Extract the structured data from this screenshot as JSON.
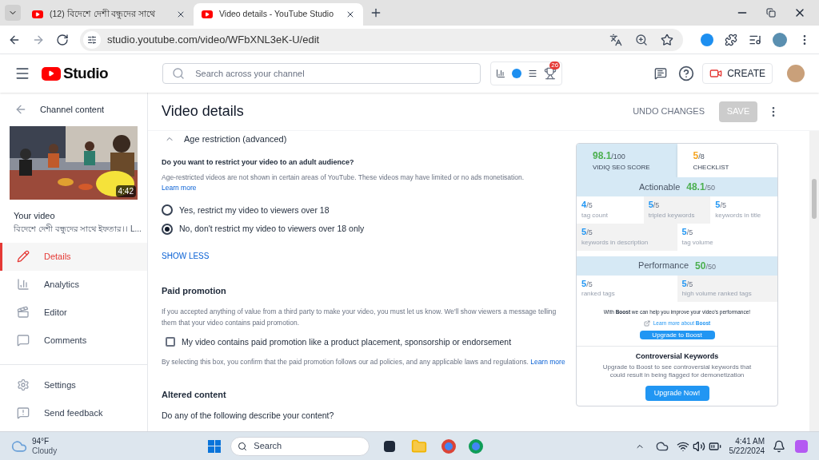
{
  "browser": {
    "tabs": [
      {
        "title": "(12) বিদেশে দেশী বন্ধুদের সাথে",
        "selected": false
      },
      {
        "title": "Video details - YouTube Studio",
        "selected": true
      }
    ],
    "url": "studio.youtube.com/video/WFbXNL3eK-U/edit"
  },
  "header": {
    "logo": "Studio",
    "search_placeholder": "Search across your channel",
    "trophy_badge": "26",
    "create": "CREATE"
  },
  "sidebar": {
    "back": "Channel content",
    "duration": "4:42",
    "your_video": "Your video",
    "video_title": "বিদেশে দেশী বন্ধুদের সাথে ইফতার।। L...",
    "nav": [
      {
        "kind": "details",
        "label": "Details",
        "selected": true
      },
      {
        "kind": "analytics",
        "label": "Analytics",
        "selected": false
      },
      {
        "kind": "editor",
        "label": "Editor",
        "selected": false
      },
      {
        "kind": "comments",
        "label": "Comments",
        "selected": false
      }
    ],
    "footer": [
      {
        "kind": "settings",
        "label": "Settings"
      },
      {
        "kind": "feedback",
        "label": "Send feedback"
      }
    ]
  },
  "page": {
    "title": "Video details",
    "undo": "UNDO CHANGES",
    "save": "SAVE",
    "save_disabled": true,
    "age": {
      "heading": "Age restriction (advanced)",
      "expanded": true,
      "question": "Do you want to restrict your video to an adult audience?",
      "note": "Age-restricted videos are not shown in certain areas of YouTube. These videos may have limited or no ads monetisation.",
      "learn_more": "Learn more",
      "options": [
        {
          "label": "Yes, restrict my video to viewers over 18",
          "selected": false
        },
        {
          "label": "No, don't restrict my video to viewers over 18 only",
          "selected": true
        }
      ],
      "show_less": "SHOW LESS"
    },
    "paid": {
      "heading": "Paid promotion",
      "note": "If you accepted anything of value from a third party to make your video, you must let us know. We'll show viewers a message telling them that your video contains paid promotion.",
      "checkbox": {
        "label": "My video contains paid promotion like a product placement, sponsorship or endorsement",
        "checked": false
      },
      "disclaimer": "By selecting this box, you confirm that the paid promotion follows our ad policies, and any applicable laws and regulations.",
      "learn_more": "Learn more"
    },
    "altered": {
      "heading": "Altered content",
      "question": "Do any of the following describe your content?"
    }
  },
  "vidiq": {
    "seo": {
      "score": "98.1",
      "max": "/100",
      "label": "VIDIQ SEO SCORE",
      "selected": true
    },
    "checklist": {
      "score": "5",
      "max": "/8",
      "label": "CHECKLIST",
      "selected": false
    },
    "actionable": {
      "title": "Actionable",
      "score": "48.1",
      "max": "/50",
      "rows": [
        [
          {
            "value": "4",
            "max": "/5",
            "label": "tag count"
          },
          {
            "value": "5",
            "max": "/5",
            "label": "tripled keywords"
          },
          {
            "value": "5",
            "max": "/5",
            "label": "keywords in title"
          }
        ],
        [
          {
            "value": "5",
            "max": "/5",
            "label": "keywords in description"
          },
          {
            "value": "5",
            "max": "/5",
            "label": "tag volume"
          }
        ]
      ]
    },
    "performance": {
      "title": "Performance",
      "score": "50",
      "max": "/50",
      "rows": [
        [
          {
            "value": "5",
            "max": "/5",
            "label": "ranked tags"
          },
          {
            "value": "5",
            "max": "/5",
            "label": "high volume ranked tags"
          }
        ]
      ]
    },
    "boost_text": "With **Boost** we can help you improve your video's performance!",
    "boost_link": "Learn more about **Boost**",
    "boost_button": "Upgrade to Boost",
    "controversial": {
      "title": "Controversial Keywords",
      "text": "Upgrade to Boost to see controversial keywords that could result in being flagged for demonetization",
      "button": "Upgrade Now!"
    }
  },
  "taskbar": {
    "temperature": "94°F",
    "weather": "Cloudy",
    "search": "Search",
    "time": "4:41 AM",
    "date": "5/22/2024"
  }
}
